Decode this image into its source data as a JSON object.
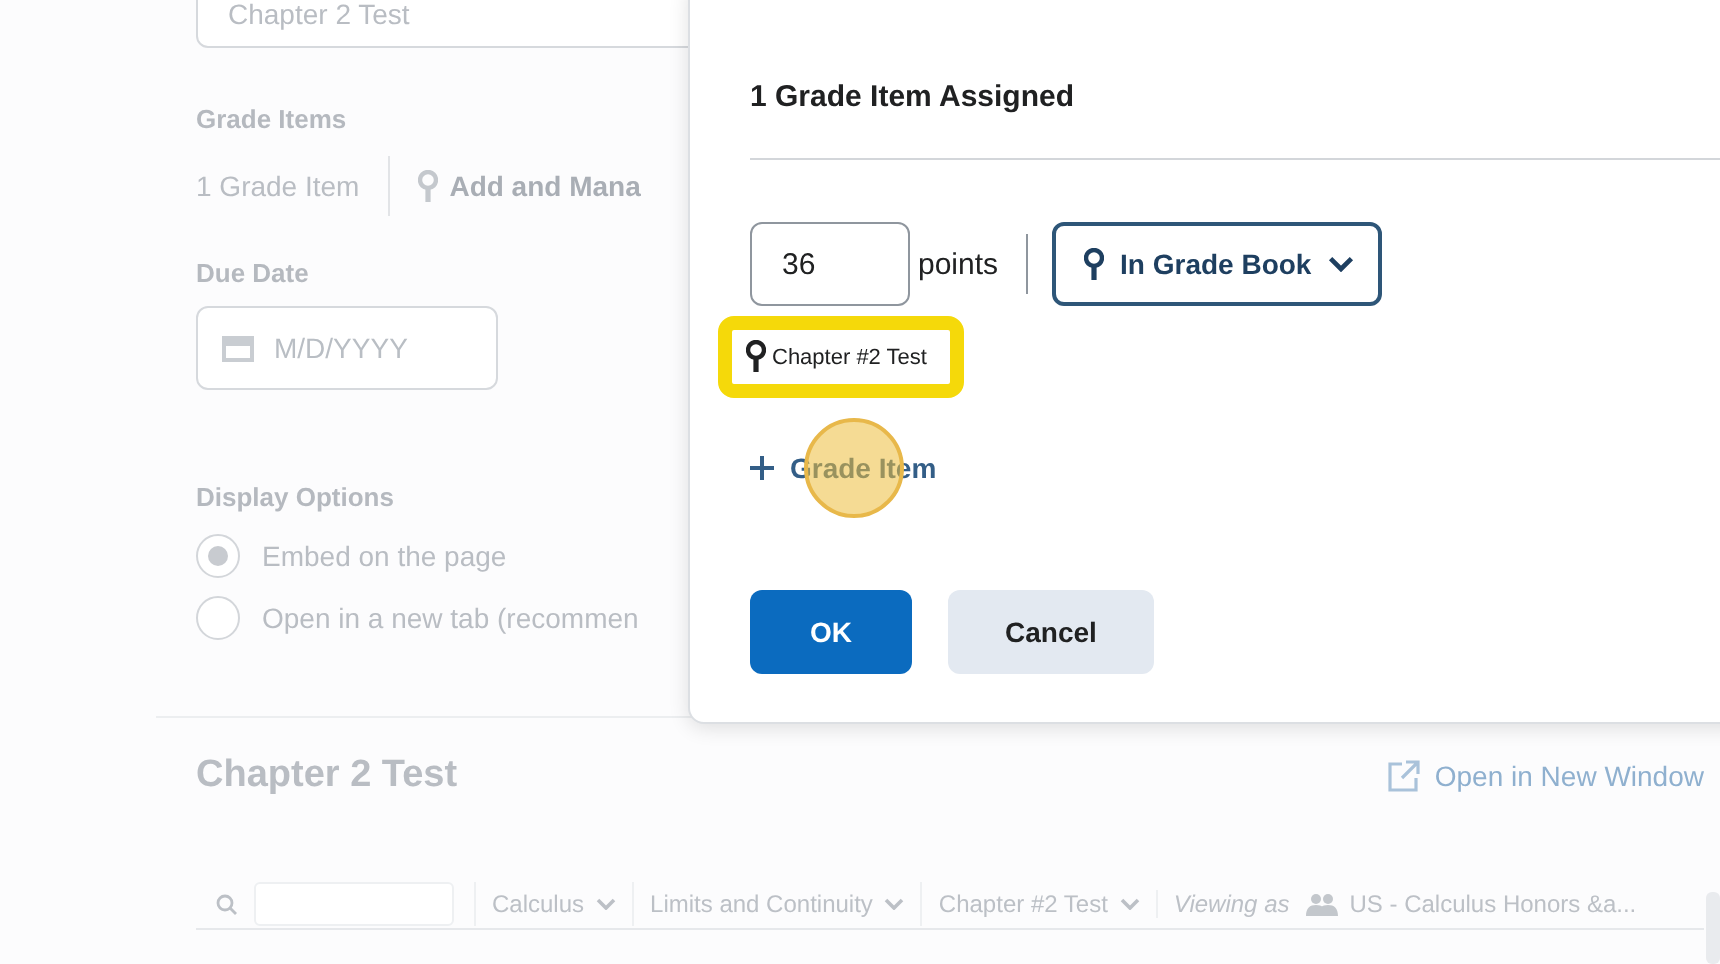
{
  "page": {
    "name_field": {
      "value": "Chapter 2 Test"
    },
    "grade_items": {
      "label": "Grade Items",
      "count": "1 Grade Item",
      "link": "Add and Mana"
    },
    "due_date": {
      "label": "Due Date",
      "placeholder": "M/D/YYYY"
    },
    "display_options": {
      "label": "Display Options",
      "options": [
        {
          "label": "Embed on the page",
          "selected": true
        },
        {
          "label": "Open in a new tab (recommen",
          "selected": false
        }
      ]
    },
    "preview": {
      "title": "Chapter 2 Test",
      "open_link": "Open in New Window"
    },
    "toolbar": {
      "filters": [
        "Calculus",
        "Limits and Continuity",
        "Chapter #2 Test"
      ],
      "viewing_label": "Viewing as",
      "viewing_value": "US - Calculus Honors &a..."
    }
  },
  "dialog": {
    "heading": "1 Grade Item Assigned",
    "points": {
      "value": "36",
      "label": "points"
    },
    "gradebook_button": "In Grade Book",
    "grade_items": [
      {
        "name": "Chapter #2 Test",
        "highlighted": true
      }
    ],
    "add_link": {
      "label": "Grade Item",
      "clicked": true
    },
    "buttons": [
      {
        "label": "OK",
        "kind": "primary"
      },
      {
        "label": "Cancel",
        "kind": "secondary"
      }
    ]
  }
}
